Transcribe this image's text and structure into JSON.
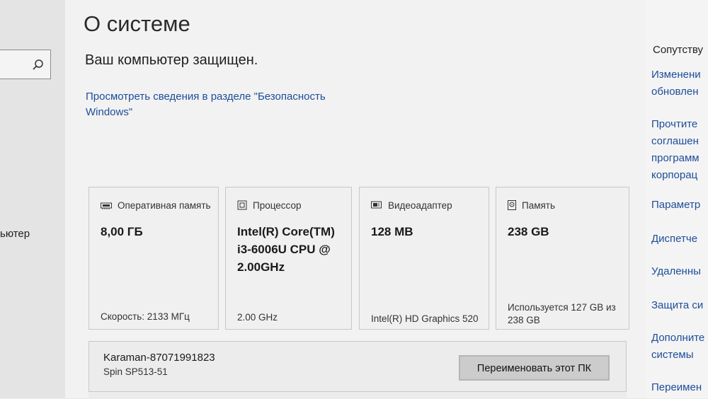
{
  "left_nav": {
    "search_icon": "search-icon",
    "partial_item": "ьютер"
  },
  "header": {
    "title": "О системе"
  },
  "security": {
    "status": "Ваш компьютер защищен.",
    "link": "Просмотреть сведения в разделе \"Безопасность Windows\""
  },
  "specs": {
    "ram": {
      "icon": "memory-chip-icon",
      "label": "Оперативная память",
      "value": "8,00 ГБ",
      "detail": "Скорость: 2133 МГц"
    },
    "cpu": {
      "icon": "processor-icon",
      "label": "Процессор",
      "value": "Intel(R) Core(TM) i3-6006U CPU @ 2.00GHz",
      "detail": "2.00 GHz"
    },
    "gpu": {
      "icon": "graphics-card-icon",
      "label": "Видеоадаптер",
      "value": "128 MB",
      "detail": "Intel(R) HD Graphics 520"
    },
    "storage": {
      "icon": "storage-drive-icon",
      "label": "Память",
      "value": "238 GB",
      "detail": "Используется 127 GB из 238 GB"
    }
  },
  "device": {
    "name": "Karaman-87071991823",
    "model": "Spin SP513-51",
    "rename_button": "Переименовать этот ПК"
  },
  "related": {
    "heading": "Сопутству",
    "links": [
      [
        "Изменени",
        "обновлен"
      ],
      [
        "Прочтите",
        "соглашен",
        "программ",
        "корпорац"
      ],
      [
        "Параметр"
      ],
      [
        "Диспетче"
      ],
      [
        "Удаленны"
      ],
      [
        "Защита си"
      ],
      [
        "Дополните",
        "системы"
      ],
      [
        "Переимен"
      ]
    ]
  },
  "colors": {
    "link": "#1e4d9a",
    "button_bg": "#cccccc",
    "card_border": "#c8c8c8"
  }
}
